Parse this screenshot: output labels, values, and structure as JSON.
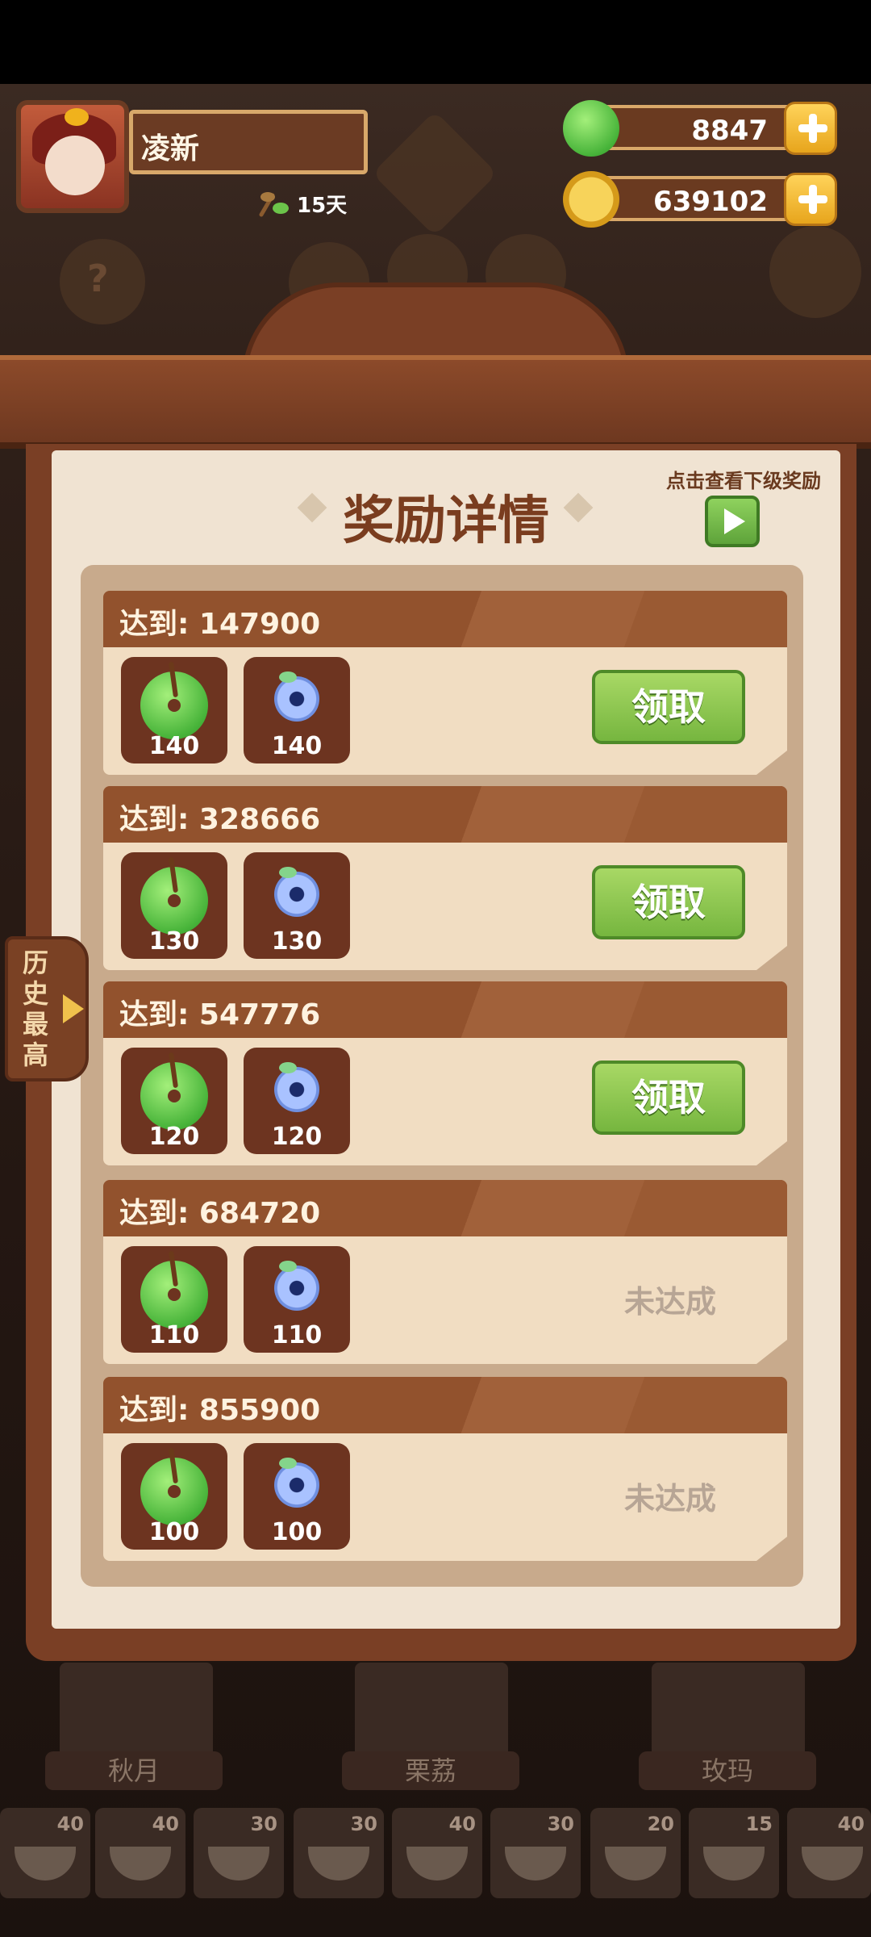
{
  "player": {
    "name": "凌新",
    "days": "15天"
  },
  "currency": {
    "jade": "8847",
    "coins": "639102"
  },
  "panel": {
    "title": "奖励详情",
    "next_hint": "点击查看下级奖励"
  },
  "side_tab": {
    "label": "历史最高"
  },
  "rewards": [
    {
      "label": "达到: 147900",
      "jade_qty": "140",
      "gem_qty": "140",
      "status": "领取"
    },
    {
      "label": "达到: 328666",
      "jade_qty": "130",
      "gem_qty": "130",
      "status": "领取"
    },
    {
      "label": "达到: 547776",
      "jade_qty": "120",
      "gem_qty": "120",
      "status": "领取"
    },
    {
      "label": "达到: 684720",
      "jade_qty": "110",
      "gem_qty": "110",
      "status": "未达成"
    },
    {
      "label": "达到: 855900",
      "jade_qty": "100",
      "gem_qty": "100",
      "status": "未达成"
    }
  ],
  "characters": [
    "秋月",
    "栗荔",
    "玫玛"
  ],
  "dishes": [
    "40",
    "40",
    "30",
    "30",
    "40",
    "30",
    "20",
    "15",
    "40"
  ],
  "colors": {
    "claim_green": "#76b63f",
    "header_brown": "#92522d",
    "paper": "#f0e3d2"
  }
}
